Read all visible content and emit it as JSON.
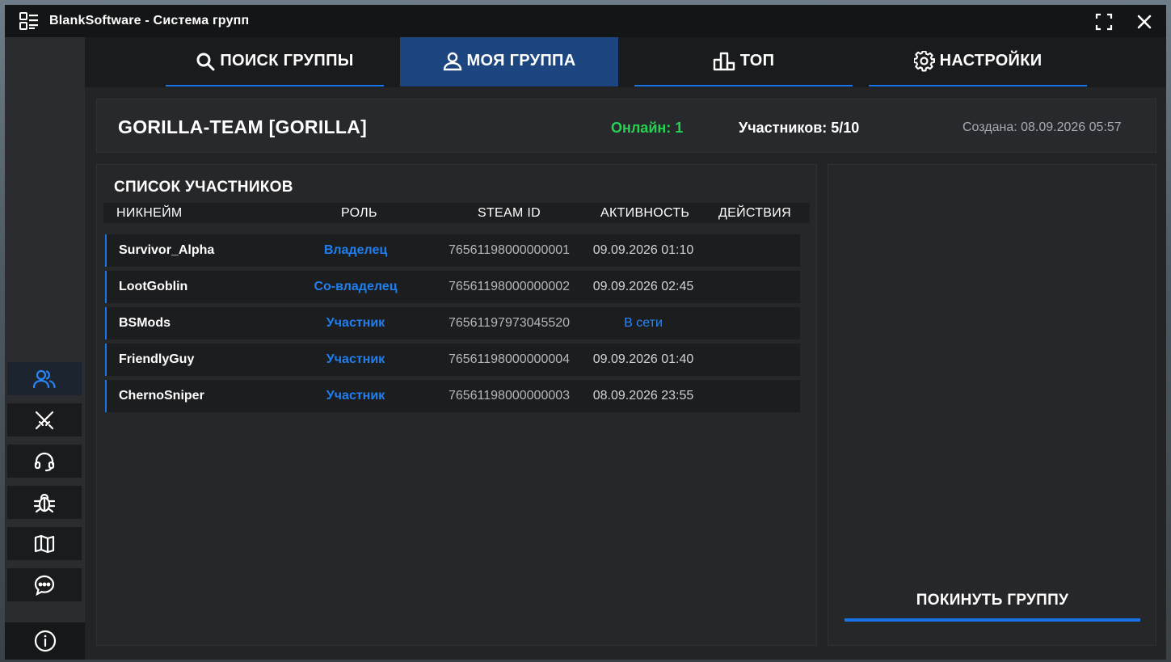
{
  "window": {
    "title": "BlankSoftware - Система групп"
  },
  "tabs": [
    {
      "label": "ПОИСК ГРУППЫ",
      "icon": "search-icon"
    },
    {
      "label": "МОЯ ГРУППА",
      "icon": "user-icon",
      "active": true
    },
    {
      "label": "ТОП",
      "icon": "podium-icon"
    },
    {
      "label": "НАСТРОЙКИ",
      "icon": "gear-icon"
    }
  ],
  "sidebar": {
    "items": [
      {
        "icon": "users-icon",
        "active": true
      },
      {
        "icon": "crossed-swords-icon"
      },
      {
        "icon": "headset-icon"
      },
      {
        "icon": "bug-icon"
      },
      {
        "icon": "map-icon"
      },
      {
        "icon": "chat-icon"
      }
    ],
    "bottom_icon": "info-icon"
  },
  "group": {
    "name": "GORILLA-TEAM [GORILLA]",
    "online": "Онлайн: 1",
    "members": "Участников: 5/10",
    "created": "Создана: 08.09.2026 05:57"
  },
  "members": {
    "title": "СПИСОК УЧАСТНИКОВ",
    "columns": [
      "НИКНЕЙМ",
      "РОЛЬ",
      "STEAM ID",
      "АКТИВНОСТЬ",
      "ДЕЙСТВИЯ"
    ],
    "rows": [
      {
        "nick": "Survivor_Alpha",
        "role": "Владелец",
        "steam": "76561198000000001",
        "activity": "09.09.2026 01:10",
        "online": false
      },
      {
        "nick": "LootGoblin",
        "role": "Со-владелец",
        "steam": "76561198000000002",
        "activity": "09.09.2026 02:45",
        "online": false
      },
      {
        "nick": "BSMods",
        "role": "Участник",
        "steam": "76561197973045520",
        "activity": "В сети",
        "online": true
      },
      {
        "nick": "FriendlyGuy",
        "role": "Участник",
        "steam": "76561198000000004",
        "activity": "09.09.2026 01:40",
        "online": false
      },
      {
        "nick": "ChernoSniper",
        "role": "Участник",
        "steam": "76561198000000003",
        "activity": "08.09.2026 23:55",
        "online": false
      }
    ]
  },
  "actions": {
    "leave_label": "ПОКИНУТЬ ГРУППУ"
  },
  "colors": {
    "accent": "#1a73e8",
    "online": "#27d152",
    "role": "#1f7ff0"
  }
}
